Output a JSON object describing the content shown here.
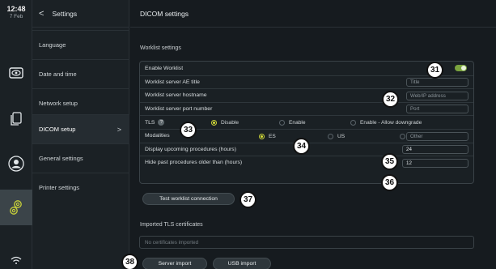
{
  "status": {
    "time": "12:48",
    "date": "7 Feb"
  },
  "rail": {
    "icons": [
      "display-icon",
      "files-icon",
      "user-icon",
      "settings-gear-icon",
      "wifi-icon"
    ]
  },
  "menu": {
    "back_label": "<",
    "title": "Settings",
    "items": [
      {
        "label": "Language"
      },
      {
        "label": "Date and time"
      },
      {
        "label": "Network setup"
      },
      {
        "label": "DICOM setup",
        "chevron": ">"
      },
      {
        "label": "General settings"
      },
      {
        "label": "Printer settings"
      }
    ]
  },
  "main": {
    "title": "DICOM settings",
    "worklist_section": "Worklist settings",
    "rows": {
      "enable": {
        "label": "Enable Worklist"
      },
      "ae_title": {
        "label": "Worklist server AE title",
        "placeholder": "Title"
      },
      "hostname": {
        "label": "Worklist server hostname",
        "placeholder": "Web/IP address"
      },
      "port": {
        "label": "Worklist server port number",
        "placeholder": "Port"
      },
      "tls": {
        "label": "TLS",
        "help": "?",
        "options": [
          "Disable",
          "Enable",
          "Enable - Allow downgrade"
        ],
        "selected": "Disable"
      },
      "modalities": {
        "label": "Modalities",
        "options": [
          "ES",
          "US"
        ],
        "selected": "ES",
        "other_placeholder": "Other"
      },
      "upcoming": {
        "label": "Display upcoming procedures (hours)",
        "value": "24"
      },
      "past": {
        "label": "Hide past procedures older than (hours)",
        "value": "12"
      }
    },
    "test_button": "Test worklist connection",
    "certs_section": "Imported TLS certificates",
    "certs_empty": "No certificates imported",
    "server_import": "Server import",
    "usb_import": "USB import"
  },
  "callouts": [
    "31",
    "32",
    "33",
    "34",
    "35",
    "36",
    "37",
    "38"
  ],
  "colors": {
    "accent_toggle": "#7aa33e",
    "radio_selected": "#d9e236"
  }
}
